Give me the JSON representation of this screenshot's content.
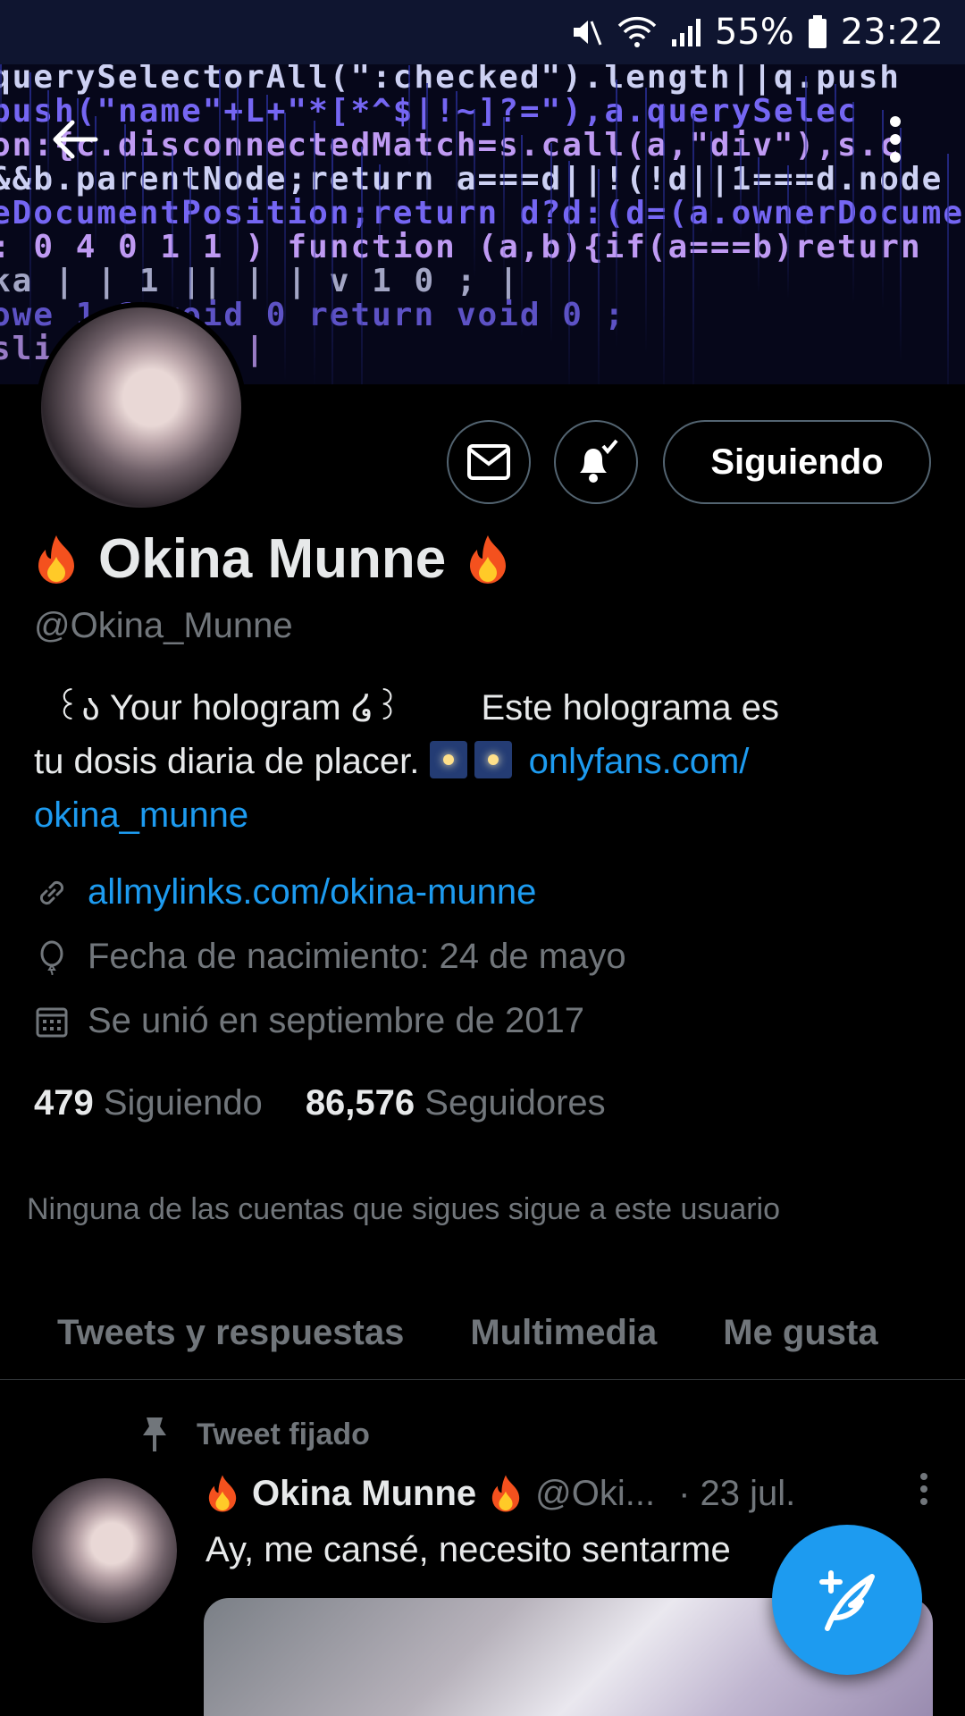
{
  "status_bar": {
    "battery": "55%",
    "time": "23:22"
  },
  "banner": {
    "code_lines": [
      "querySelectorAll(\":checked\").length||q.push",
      "push(\"name\"+L+\"*[*^$|!~]?=\"),a.querySelec",
      "on:{c.disconnectedMatch=s.call(a,\"div\"),s.c",
      "&&b.parentNode;return a===d||!(!d||1===d.node",
      "eDocumentPosition;return d?d:(d=(a.ownerDocume",
      ": 0 4 0 1 1 ) function (a,b){if(a===b)return",
      " ka      |  |  1   ||  |  | v 1 0 ; |",
      "owe      1  1      void 0 return void 0 ;",
      "          slice 0    bar            |"
    ]
  },
  "profile": {
    "name": "Okina Munne",
    "handle": "@Okina_Munne",
    "follow_button": "Siguiendo",
    "bio_line1": "  ꒰ა Your hologram ໒꒱        Este holograma es",
    "bio_line2_text": "tu dosis diaria de placer.",
    "bio_link_part1": "onlyfans.com/",
    "bio_link_part2": "okina_munne",
    "website": "allmylinks.com/okina-munne",
    "birthday": "Fecha de nacimiento: 24 de mayo",
    "joined": "Se unió en septiembre de 2017",
    "following_count": "479",
    "following_label": "Siguiendo",
    "followers_count": "86,576",
    "followers_label": "Seguidores",
    "followed_by_note": "Ninguna de las cuentas que sigues sigue a este usuario"
  },
  "tabs": [
    "Tweets y respuestas",
    "Multimedia",
    "Me gusta"
  ],
  "pinned_tweet": {
    "label": "Tweet fijado",
    "name": "Okina Munne",
    "handle": "@Oki...",
    "date": "· 23 jul.",
    "text": "Ay, me cansé, necesito sentarme"
  },
  "colors": {
    "accent": "#1d9bf0",
    "secondary_text": "#71767b",
    "status_bar_bg": "#0f1530",
    "banner_code_white": "#d8dcff",
    "banner_code_purple": "#7b6cff",
    "banner_code_pink": "#c9a2ff"
  },
  "icons": {
    "back": "arrow-left-icon",
    "more": "more-vertical-icon",
    "message": "envelope-icon",
    "notifications": "bell-check-icon",
    "website": "link-icon",
    "birthday": "balloon-icon",
    "joined": "calendar-icon",
    "pinned": "pin-icon",
    "compose": "compose-feather-icon"
  }
}
